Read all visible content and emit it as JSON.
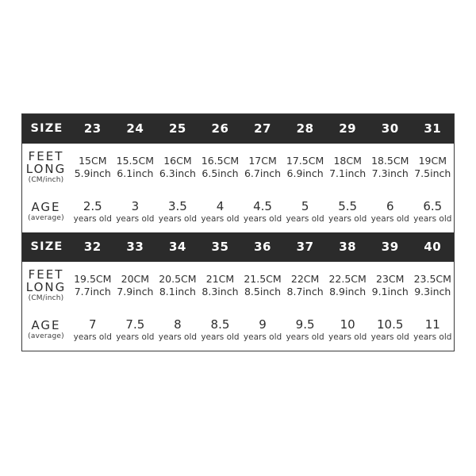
{
  "chart": {
    "accent_color": "#2b2b2b",
    "background_color": "#ffffff",
    "text_color": "#303030",
    "sections": [
      {
        "header": {
          "label": "SIZE",
          "sizes": [
            "23",
            "24",
            "25",
            "26",
            "27",
            "28",
            "29",
            "30",
            "31"
          ]
        },
        "rows": [
          {
            "label_main": "FEET LONG",
            "label_sub": "(CM/inch)",
            "cells": [
              {
                "top": "15CM",
                "bottom": "5.9inch"
              },
              {
                "top": "15.5CM",
                "bottom": "6.1inch"
              },
              {
                "top": "16CM",
                "bottom": "6.3inch"
              },
              {
                "top": "16.5CM",
                "bottom": "6.5inch"
              },
              {
                "top": "17CM",
                "bottom": "6.7inch"
              },
              {
                "top": "17.5CM",
                "bottom": "6.9inch"
              },
              {
                "top": "18CM",
                "bottom": "7.1inch"
              },
              {
                "top": "18.5CM",
                "bottom": "7.3inch"
              },
              {
                "top": "19CM",
                "bottom": "7.5inch"
              }
            ]
          },
          {
            "label_main": "AGE",
            "label_sub": "(average)",
            "cells": [
              {
                "top": "2.5",
                "bottom": "years old"
              },
              {
                "top": "3",
                "bottom": "years old"
              },
              {
                "top": "3.5",
                "bottom": "years old"
              },
              {
                "top": "4",
                "bottom": "years old"
              },
              {
                "top": "4.5",
                "bottom": "years old"
              },
              {
                "top": "5",
                "bottom": "years old"
              },
              {
                "top": "5.5",
                "bottom": "years old"
              },
              {
                "top": "6",
                "bottom": "years old"
              },
              {
                "top": "6.5",
                "bottom": "years old"
              }
            ]
          }
        ]
      },
      {
        "header": {
          "label": "SIZE",
          "sizes": [
            "32",
            "33",
            "34",
            "35",
            "36",
            "37",
            "38",
            "39",
            "40"
          ]
        },
        "rows": [
          {
            "label_main": "FEET LONG",
            "label_sub": "(CM/inch)",
            "cells": [
              {
                "top": "19.5CM",
                "bottom": "7.7inch"
              },
              {
                "top": "20CM",
                "bottom": "7.9inch"
              },
              {
                "top": "20.5CM",
                "bottom": "8.1inch"
              },
              {
                "top": "21CM",
                "bottom": "8.3inch"
              },
              {
                "top": "21.5CM",
                "bottom": "8.5inch"
              },
              {
                "top": "22CM",
                "bottom": "8.7inch"
              },
              {
                "top": "22.5CM",
                "bottom": "8.9inch"
              },
              {
                "top": "23CM",
                "bottom": "9.1inch"
              },
              {
                "top": "23.5CM",
                "bottom": "9.3inch"
              }
            ]
          },
          {
            "label_main": "AGE",
            "label_sub": "(average)",
            "cells": [
              {
                "top": "7",
                "bottom": "years old"
              },
              {
                "top": "7.5",
                "bottom": "years old"
              },
              {
                "top": "8",
                "bottom": "years old"
              },
              {
                "top": "8.5",
                "bottom": "years old"
              },
              {
                "top": "9",
                "bottom": "years old"
              },
              {
                "top": "9.5",
                "bottom": "years old"
              },
              {
                "top": "10",
                "bottom": "years old"
              },
              {
                "top": "10.5",
                "bottom": "years old"
              },
              {
                "top": "11",
                "bottom": "years old"
              }
            ]
          }
        ]
      }
    ]
  }
}
